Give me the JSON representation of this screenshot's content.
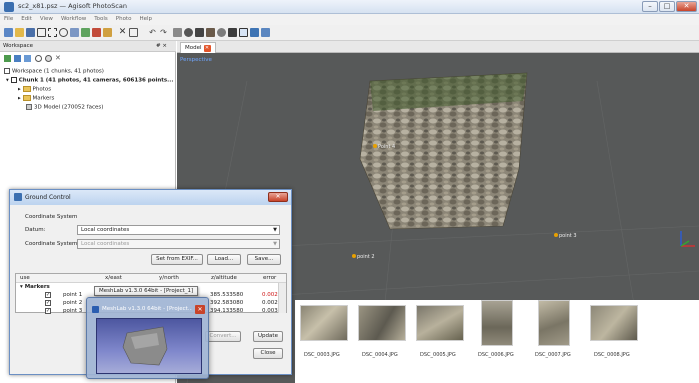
{
  "window": {
    "title": "sc2_x81.psz — Agisoft PhotoScan",
    "minimize": "–",
    "maximize": "□",
    "close": "✕"
  },
  "menu": [
    "File",
    "Edit",
    "View",
    "Workflow",
    "Tools",
    "Photo",
    "Help"
  ],
  "workspace": {
    "title": "Workspace",
    "header_controls": "# ×",
    "root": "Workspace (1 chunks, 41 photos)",
    "chunk": "Chunk 1 (41 photos, 41 cameras, 606136 points...",
    "photos": "Photos",
    "markers": "Markers",
    "model": "3D Model (270052 faces)"
  },
  "viewport": {
    "tab": "Model",
    "view_label": "Perspective",
    "markers": [
      "Point 4",
      "point 3",
      "point 2"
    ]
  },
  "ground_control": {
    "title": "Ground Control",
    "section": "Coordinate System",
    "datum_label": "Datum:",
    "datum_value": "Local coordinates",
    "cs_label": "Coordinate System:",
    "cs_value": "Local coordinates",
    "import_button": "Set from EXIF...",
    "load_button": "Load...",
    "save_button": "Save...",
    "columns": [
      "use",
      "x/east",
      "y/north",
      "z/altitude",
      "error"
    ],
    "group": "Markers",
    "rows": [
      {
        "name": "point 1",
        "z": "385.533580",
        "error": "0.002",
        "error_color": "#cc1111"
      },
      {
        "name": "point 2",
        "z": "392.583080",
        "error": "0.002",
        "error_color": "#222222"
      },
      {
        "name": "point 3",
        "z": "394.133580",
        "error": "0.003",
        "error_color": "#222222"
      }
    ],
    "tooltip": "MeshLab v1.3.0 64bit - [Project_1]",
    "convert_button": "Convert...",
    "update_button": "Update",
    "close_button": "Close"
  },
  "photos": [
    "DSC_0003.JPG",
    "DSC_0004.JPG",
    "DSC_0005.JPG",
    "DSC_0006.JPG",
    "DSC_0007.JPG",
    "DSC_0008.JPG"
  ],
  "preview": {
    "title": "MeshLab v1.3.0 64bit - [Project...",
    "close": "✕"
  },
  "colors": {
    "viewport": "#575959",
    "accent": "#6b8fc3",
    "marker": "#e8a000",
    "error_red": "#cc1111"
  }
}
